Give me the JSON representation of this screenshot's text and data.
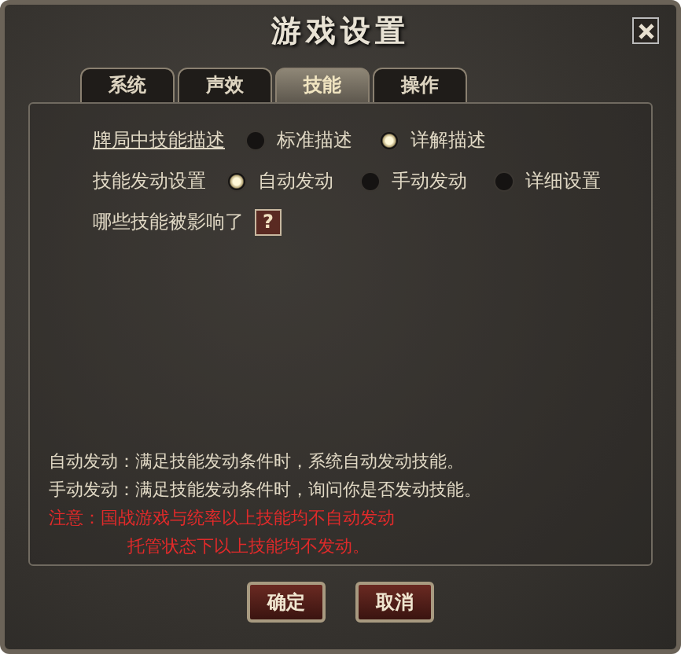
{
  "window": {
    "title": "游戏设置"
  },
  "tabs": [
    {
      "label": "系统",
      "selected": false
    },
    {
      "label": "声效",
      "selected": false
    },
    {
      "label": "技能",
      "selected": true
    },
    {
      "label": "操作",
      "selected": false
    }
  ],
  "option_groups": [
    {
      "label": "牌局中技能描述",
      "underlined": true,
      "options": [
        {
          "label": "标准描述",
          "selected": false
        },
        {
          "label": "详解描述",
          "selected": true
        }
      ]
    },
    {
      "label": "技能发动设置",
      "underlined": false,
      "options": [
        {
          "label": "自动发动",
          "selected": true
        },
        {
          "label": "手动发动",
          "selected": false
        },
        {
          "label": "详细设置",
          "selected": false
        }
      ]
    }
  ],
  "help_row": {
    "label": "哪些技能被影响了",
    "button": "?"
  },
  "notes": [
    {
      "kind": "info",
      "text": "自动发动：满足技能发动条件时，系统自动发动技能。"
    },
    {
      "kind": "info",
      "text": "手动发动：满足技能发动条件时，询问你是否发动技能。"
    },
    {
      "kind": "warning",
      "text": "注意：国战游戏与统率以上技能均不自动发动"
    },
    {
      "kind": "warning-indented",
      "text": "托管状态下以上技能均不发动。"
    }
  ],
  "buttons": [
    "确定",
    "取消"
  ]
}
